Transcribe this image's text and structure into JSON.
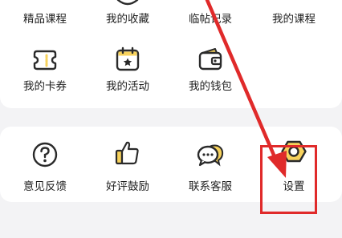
{
  "row1": [
    {
      "label": "精品课程"
    },
    {
      "label": "我的收藏"
    },
    {
      "label": "临帖记录"
    },
    {
      "label": "我的课程"
    }
  ],
  "row2": [
    {
      "label": "我的卡券",
      "icon": "ticket-icon"
    },
    {
      "label": "我的活动",
      "icon": "calendar-star-icon"
    },
    {
      "label": "我的钱包",
      "icon": "wallet-icon"
    }
  ],
  "row3": [
    {
      "label": "意见反馈",
      "icon": "question-icon"
    },
    {
      "label": "好评鼓励",
      "icon": "thumbs-up-icon"
    },
    {
      "label": "联系客服",
      "icon": "chat-bubbles-icon"
    },
    {
      "label": "设置",
      "icon": "settings-hexagon-icon"
    }
  ],
  "colors": {
    "accent": "#f7d25c",
    "icon_stroke": "#2a2a2a",
    "annotation": "#e02a2a"
  }
}
